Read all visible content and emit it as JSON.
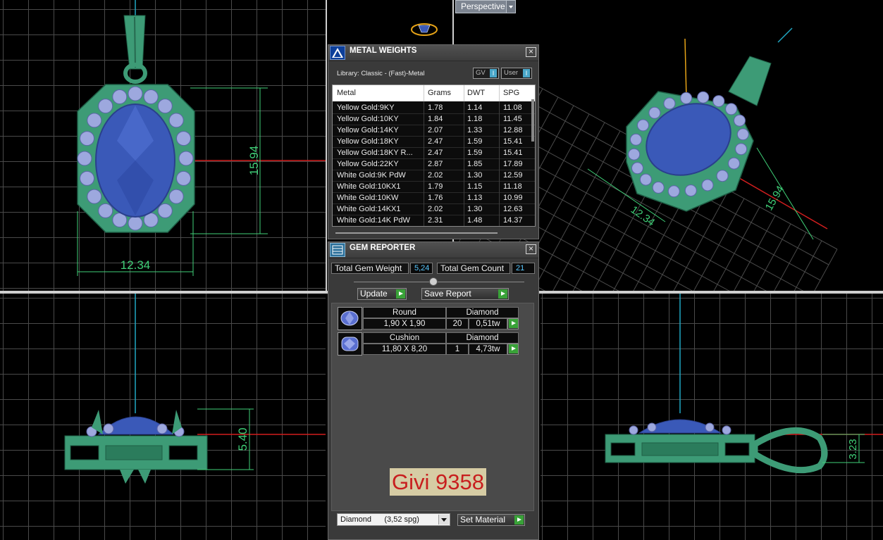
{
  "viewport": {
    "perspective_label": "Perspective",
    "dimensions": {
      "front_height": "15.94",
      "front_width": "12.34",
      "side_height": "5.40",
      "side_height_right": "3.23",
      "persp_width": "12.34",
      "persp_height": "15.94"
    }
  },
  "metal_weights": {
    "title": "METAL WEIGHTS",
    "library": "Library: Classic - (Fast)-Metal",
    "toggle_gv": "GV",
    "toggle_user": "User",
    "toggle_mark": "I",
    "columns": [
      "Metal",
      "Grams",
      "DWT",
      "SPG"
    ],
    "rows": [
      [
        "Yellow Gold:9KY",
        "1.78",
        "1.14",
        "11.08"
      ],
      [
        "Yellow Gold:10KY",
        "1.84",
        "1.18",
        "11.45"
      ],
      [
        "Yellow Gold:14KY",
        "2.07",
        "1.33",
        "12.88"
      ],
      [
        "Yellow Gold:18KY",
        "2.47",
        "1.59",
        "15.41"
      ],
      [
        "Yellow Gold:18KY R...",
        "2.47",
        "1.59",
        "15.41"
      ],
      [
        "Yellow Gold:22KY",
        "2.87",
        "1.85",
        "17.89"
      ],
      [
        "White Gold:9K PdW",
        "2.02",
        "1.30",
        "12.59"
      ],
      [
        "White Gold:10KX1",
        "1.79",
        "1.15",
        "11.18"
      ],
      [
        "White Gold:10KW",
        "1.76",
        "1.13",
        "10.99"
      ],
      [
        "White Gold:14KX1",
        "2.02",
        "1.30",
        "12.63"
      ],
      [
        "White Gold:14K PdW",
        "2.31",
        "1.48",
        "14.37"
      ]
    ]
  },
  "gem_reporter": {
    "title": "GEM REPORTER",
    "total_weight_label": "Total Gem Weight",
    "total_weight_value": "5,24",
    "total_count_label": "Total Gem Count",
    "total_count_value": "21",
    "update_label": "Update",
    "save_report_label": "Save Report",
    "gems": [
      {
        "shape": "Round",
        "material": "Diamond",
        "size": "1,90 X 1,90",
        "count": "20",
        "weight": "0,51tw"
      },
      {
        "shape": "Cushion",
        "material": "Diamond",
        "size": "11,80 X 8,20",
        "count": "1",
        "weight": "4,73tw"
      }
    ],
    "watermark": "Givi 9358",
    "material_select": "Diamond      (3,52 spg)",
    "set_material_label": "Set Material"
  },
  "colors": {
    "metal_green": "#3d9b76",
    "gem_blue": "#3a59b8",
    "halo_lavender": "#9da8de",
    "axis_red": "#d21e1e",
    "axis_cyan": "#21a8c4",
    "dim_line": "#3fcf77"
  }
}
